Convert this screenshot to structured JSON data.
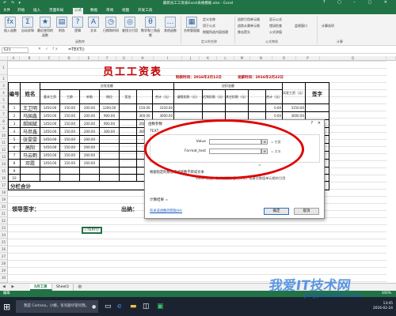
{
  "window": {
    "title": "最新员工工资表Excel表格模板.xlsx - Excel",
    "quick_access": "↶ ↷ ▾",
    "controls": "? ▢ – ▢ ✕"
  },
  "ribbon": {
    "tabs": [
      "文件",
      "开始",
      "插入",
      "页面布局",
      "公式",
      "数据",
      "审阅",
      "视图",
      "开发工具"
    ],
    "active_tab": "公式",
    "buttons": [
      {
        "icon": "fx",
        "label": "插入函数"
      },
      {
        "icon": "Σ",
        "label": "自动求和"
      },
      {
        "icon": "★",
        "label": "最近使用的函数"
      },
      {
        "icon": "▤",
        "label": "财务"
      },
      {
        "icon": "?",
        "label": "逻辑"
      },
      {
        "icon": "A",
        "label": "文本"
      },
      {
        "icon": "◷",
        "label": "日期和时间"
      },
      {
        "icon": "◎",
        "label": "查找与引用"
      },
      {
        "icon": "θ",
        "label": "数学和三角函数"
      },
      {
        "icon": "…",
        "label": "其他函数"
      },
      {
        "icon": "▦",
        "label": "名称管理器"
      }
    ],
    "small_items": [
      "定义名称",
      "用于公式",
      "根据所选内容创建",
      "追踪引用单元格",
      "追踪从属单元格",
      "移去箭头",
      "显示公式",
      "错误检查",
      "公式求值",
      "监视窗口",
      "计算选项"
    ],
    "groups": [
      "函数库",
      "定义的名称",
      "公式审核",
      "计算"
    ]
  },
  "formula_bar": {
    "name_box": "E21",
    "icons": "✕ ✓ fx",
    "content": "=TEXT()"
  },
  "columns": [
    "A",
    "B",
    "C",
    "D",
    "E",
    "F",
    "G",
    "H",
    "I",
    "J",
    "K",
    "L",
    "M",
    "N",
    "O",
    "P",
    "Q"
  ],
  "rows": [
    "1",
    "2",
    "3",
    "4",
    "5",
    "6",
    "7",
    "8",
    "9",
    "10",
    "11",
    "12",
    "13",
    "14",
    "15",
    "16",
    "17",
    "18",
    "19",
    "20",
    "21",
    "22",
    "23",
    "24",
    "25",
    "26",
    "27",
    "28",
    "29",
    "30"
  ],
  "sheet": {
    "title": "员工工资表",
    "prepared_label": "制表时间：2016年2月12日",
    "pay_period_label": "发薪时间：2016年2月22日",
    "headers": {
      "seq": "编号",
      "name": "姓名",
      "payable_group": "应发金额",
      "deduct_group": "应扣金额",
      "base": "基本工资",
      "seniority": "工龄",
      "subsidy": "补助",
      "post": "岗位",
      "bonus": "奖金",
      "total": "合计（元）",
      "leave": "请假扣款（元）",
      "insurance1": "迟到扣款（元）",
      "insurance2": "其它扣款（元）",
      "deduct_total": "合计（元）",
      "net": "实发工资（元）",
      "sign": "签字"
    },
    "employees": [
      {
        "no": "1",
        "name": "王卫明",
        "base": "1450.00",
        "seniority": "150.00",
        "subsidy": "200.00",
        "post": "1200.00",
        "bonus": "150.00",
        "total": "3150.00",
        "deduct": "0.00",
        "net": "3150.00"
      },
      {
        "no": "2",
        "name": "马国鑫",
        "base": "1450.00",
        "seniority": "150.00",
        "subsidy": "200.00",
        "post": "900.00",
        "bonus": "300.00",
        "total": "3000.00",
        "deduct": "0.00",
        "net": "3000.00"
      },
      {
        "no": "3",
        "name": "郝国斌",
        "base": "1450.00",
        "seniority": "150.00",
        "subsidy": "200.00",
        "post": "900.00",
        "bonus": "200.00",
        "total": "2900.00",
        "deduct": "0.00",
        "net": "2900.00"
      },
      {
        "no": "4",
        "name": "马世鑫",
        "base": "1450.00",
        "seniority": "150.00",
        "subsidy": "200.00",
        "post": "300.00",
        "bonus": "300.00",
        "total": "",
        "deduct": "",
        "net": ""
      },
      {
        "no": "5",
        "name": "张雯雯",
        "base": "1450.00",
        "seniority": "150.00",
        "subsidy": "200.00",
        "post": "",
        "bonus": "",
        "total": "",
        "deduct": "",
        "net": ""
      },
      {
        "no": "6",
        "name": "高阳",
        "base": "1450.00",
        "seniority": "150.00",
        "subsidy": "200.00",
        "post": "",
        "bonus": "",
        "total": "",
        "deduct": "",
        "net": ""
      },
      {
        "no": "7",
        "name": "马云鹤",
        "base": "1450.00",
        "seniority": "150.00",
        "subsidy": "200.00",
        "post": "",
        "bonus": "",
        "total": "",
        "deduct": "",
        "net": ""
      },
      {
        "no": "8",
        "name": "邓霞",
        "base": "1450.00",
        "seniority": "150.00",
        "subsidy": "200.00",
        "post": "",
        "bonus": "",
        "total": "",
        "deduct": "",
        "net": ""
      },
      {
        "no": "9",
        "name": "",
        "base": "",
        "seniority": "",
        "subsidy": "",
        "post": "",
        "bonus": "",
        "total": "0.00",
        "deduct": "",
        "net": ""
      },
      {
        "no": "10",
        "name": "",
        "base": "",
        "seniority": "",
        "subsidy": "",
        "post": "",
        "bonus": "",
        "total": "0.00",
        "deduct": "",
        "net": ""
      }
    ],
    "total_row_label": "分栏合计",
    "total_row_values": [
      "0.00",
      "0.00"
    ],
    "leader_sign": "领导签字：",
    "cashier_sign": "出纳：",
    "editing_cell_value": "=TEXT()"
  },
  "dialog": {
    "title": "函数参数",
    "help_button": "?",
    "close_button": "✕",
    "function_name": "TEXT",
    "params": [
      {
        "label": "Value",
        "hint": "= 任意"
      },
      {
        "label": "Format_text",
        "hint": "= 文本"
      }
    ],
    "ref_glyph": "⊞",
    "equals": "=",
    "description": "根据指定的数值格式将数字转成文本",
    "param_description": "Value  数值、能够返回数值的公式，或者对数值单元格的引用",
    "result_label": "计算结果 =",
    "help_link": "有关该函数的帮助(H)",
    "ok_label": "确定",
    "cancel_label": "取消"
  },
  "sheet_tabs": {
    "nav": "◀ ▶",
    "tabs": [
      "5月工资",
      "Sheet3"
    ],
    "active": "5月工资",
    "add": "⊕"
  },
  "status_bar": {
    "mode": "编辑",
    "zoom": "100%"
  },
  "taskbar": {
    "search_placeholder": "我是 Cortana，小娜。有问题尽管问我。",
    "time": "13:45",
    "date": "2016-02-24"
  },
  "watermark": {
    "text": "我爱IT技术网",
    "url": "jingyan.baidu.com"
  },
  "colors": {
    "excel_green": "#217346",
    "title_red": "#c00000",
    "annotation_red": "#e00000"
  }
}
